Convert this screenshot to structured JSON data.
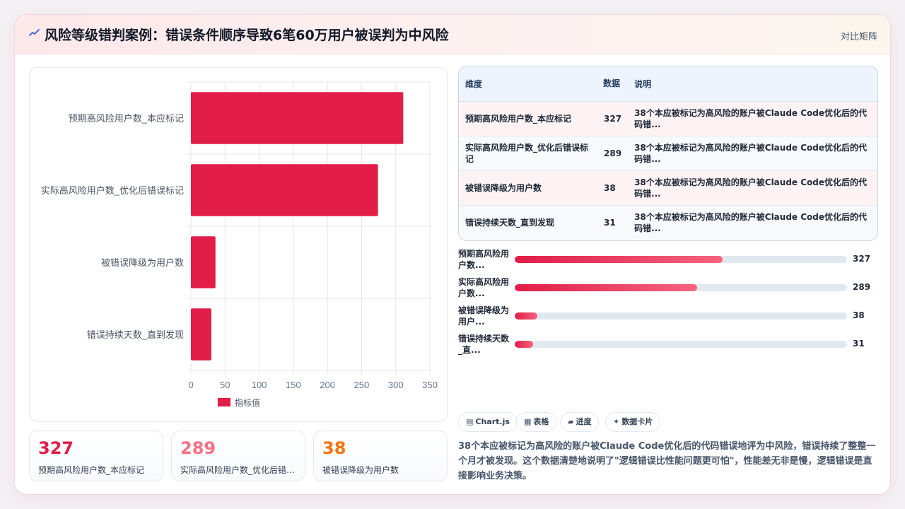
{
  "header": {
    "title": "风险等级错判案例：错误条件顺序导致6笔60万用户被误判为中风险",
    "link": "对比矩阵"
  },
  "colors": {
    "primary": "#e11d48",
    "secondary": "#f87185",
    "accent": "#f97316"
  },
  "chart_data": {
    "type": "bar",
    "orientation": "horizontal",
    "categories": [
      "预期高风险用户数_本应标记",
      "实际高风险用户数_优化后错误标记",
      "被错误降级为用户数",
      "错误持续天数_直到发现"
    ],
    "series": [
      {
        "name": "指标值",
        "values": [
          311,
          274,
          36,
          30
        ]
      }
    ],
    "xlim": [
      0,
      350
    ],
    "xticks": [
      "0",
      "50",
      "100",
      "150",
      "200",
      "250",
      "300",
      "350"
    ],
    "grid": true,
    "legend": "bottom"
  },
  "kpis": [
    {
      "value": "327",
      "label": "预期高风险用户数_本应标记",
      "color": "#e11d48"
    },
    {
      "value": "289",
      "label": "实际高风险用户数_优化后错误标记",
      "color": "#f87185"
    },
    {
      "value": "38",
      "label": "被错误降级为用户数",
      "color": "#f97316"
    }
  ],
  "table": {
    "headers": [
      "维度",
      "数据",
      "说明"
    ],
    "rows": [
      {
        "dim": "预期高风险用户数_本应标记",
        "value": "327",
        "desc": "38个本应被标记为高风险的账户被Claude Code优化后的代码错..."
      },
      {
        "dim": "实际高风险用户数_优化后错误标记",
        "value": "289",
        "desc": "38个本应被标记为高风险的账户被Claude Code优化后的代码错..."
      },
      {
        "dim": "被错误降级为用户数",
        "value": "38",
        "desc": "38个本应被标记为高风险的账户被Claude Code优化后的代码错..."
      },
      {
        "dim": "错误持续天数_直到发现",
        "value": "31",
        "desc": "38个本应被标记为高风险的账户被Claude Code优化后的代码错..."
      }
    ]
  },
  "progress": [
    {
      "label": "预期高风险用户数...",
      "value": "327",
      "fraction": 0.625
    },
    {
      "label": "实际高风险用户数...",
      "value": "289",
      "fraction": 0.548
    },
    {
      "label": "被错误降级为用户...",
      "value": "38",
      "fraction": 0.068
    },
    {
      "label": "错误持续天数_直...",
      "value": "31",
      "fraction": 0.055
    }
  ],
  "tags": [
    {
      "icon": "chart-icon",
      "label": "Chart.js"
    },
    {
      "icon": "table-icon",
      "label": "表格"
    },
    {
      "icon": "progress-icon",
      "label": "进度"
    },
    {
      "icon": "card-icon",
      "label": "数据卡片"
    }
  ],
  "summary": "38个本应被标记为高风险的账户被Claude Code优化后的代码错误地评为中风险，错误持续了整整一个月才被发现。这个数据清楚地说明了\"逻辑错误比性能问题更可怕\"，性能差无非是慢，逻辑错误是直接影响业务决策。"
}
